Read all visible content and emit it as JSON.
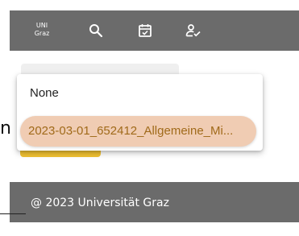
{
  "header": {
    "brand_line1": "UNI",
    "brand_line2": "Graz",
    "icons": [
      "search-icon",
      "calendar-check-icon",
      "person-check-icon"
    ]
  },
  "partial_text": "n",
  "dropdown": {
    "options": [
      {
        "label": "None"
      },
      {
        "label": "2023-03-01_652412_Allgemeine_Mi..."
      }
    ],
    "selected_index": 1
  },
  "footer": {
    "text": "@ 2023 Universität Graz"
  },
  "colors": {
    "bar": "#6b6b6b",
    "selected_bg": "#f0ccb3",
    "selected_text": "#a06a1a",
    "accent_button": "#f1c232"
  }
}
